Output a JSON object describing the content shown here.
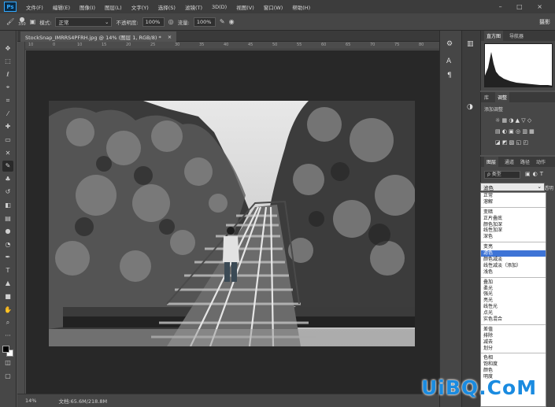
{
  "app": {
    "logo": "Ps"
  },
  "menu": [
    "文件(F)",
    "编辑(E)",
    "图像(I)",
    "图层(L)",
    "文字(Y)",
    "选择(S)",
    "滤镜(T)",
    "3D(D)",
    "视图(V)",
    "窗口(W)",
    "帮助(H)"
  ],
  "window_controls": "– □ ×",
  "options": {
    "brush_size": "350",
    "mode_label": "模式:",
    "mode_value": "正常",
    "opacity_label": "不透明度:",
    "opacity_value": "100%",
    "flow_label": "流量:",
    "flow_value": "100%",
    "workspace": "摄影"
  },
  "document": {
    "tab_title": "StockSnap_IMRRS4PFRH.jpg @ 14% (图层 1, RGB/8) *",
    "close": "×"
  },
  "ruler_h_ticks": [
    "10",
    "0",
    "10",
    "15",
    "20",
    "25",
    "30",
    "35",
    "40",
    "45",
    "50",
    "55",
    "60",
    "65",
    "70",
    "75",
    "80"
  ],
  "status": {
    "zoom": "14%",
    "doc": "文档:65.6M/218.8M"
  },
  "panels": {
    "histogram_tabs": [
      "直方图",
      "导航器"
    ],
    "adjust_tabs": [
      "库",
      "调整"
    ],
    "adjust_hint": "添加调整",
    "adjust_row1": "☼ ▦ ◑ ▲ ▽ ◇",
    "adjust_row2": "▤ ◐ ▣ ◎ ▥ ▦",
    "adjust_row3": "◪ ◩ ▧ ◱ ◰",
    "layers_tabs": [
      "图层",
      "通道",
      "路径",
      "动作"
    ],
    "filter_label": "ρ 类型",
    "blend_current": "滤色",
    "opacity_right": "不透明"
  },
  "blend_modes": [
    [
      "正常",
      "溶解"
    ],
    [
      "变暗",
      "正片叠底",
      "颜色加深",
      "线性加深",
      "深色"
    ],
    [
      "变亮",
      "滤色",
      "颜色减淡",
      "线性减淡（添加）",
      "浅色"
    ],
    [
      "叠加",
      "柔光",
      "强光",
      "亮光",
      "线性光",
      "点光",
      "实色混合"
    ],
    [
      "差值",
      "排除",
      "减去",
      "划分"
    ],
    [
      "色相",
      "饱和度",
      "颜色",
      "明度"
    ]
  ],
  "selected_blend": "滤色",
  "watermark": "UiBQ.CoM",
  "colors": {
    "accent": "#31a8ff",
    "selection": "#3e74d6",
    "watermark": "#1a8be0"
  }
}
